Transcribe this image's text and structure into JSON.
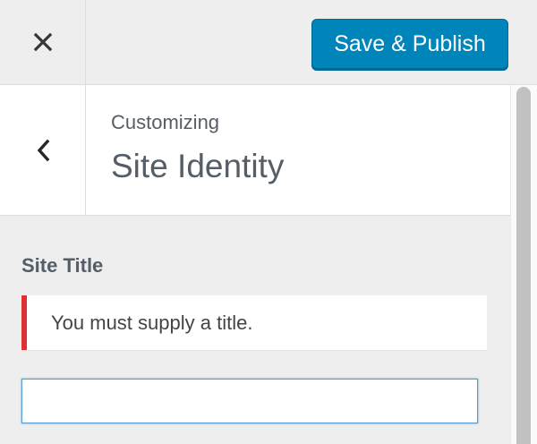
{
  "header": {
    "publish_label": "Save & Publish",
    "close_icon": "close-icon"
  },
  "section": {
    "back_icon": "chevron-left-icon",
    "subtitle": "Customizing",
    "title": "Site Identity"
  },
  "site_title_control": {
    "label": "Site Title",
    "error_message": "You must supply a title.",
    "value": ""
  },
  "colors": {
    "primary_button": "#0085ba",
    "error_border": "#dc3232",
    "input_focus": "#5b9dd9",
    "text": "#555d66"
  }
}
